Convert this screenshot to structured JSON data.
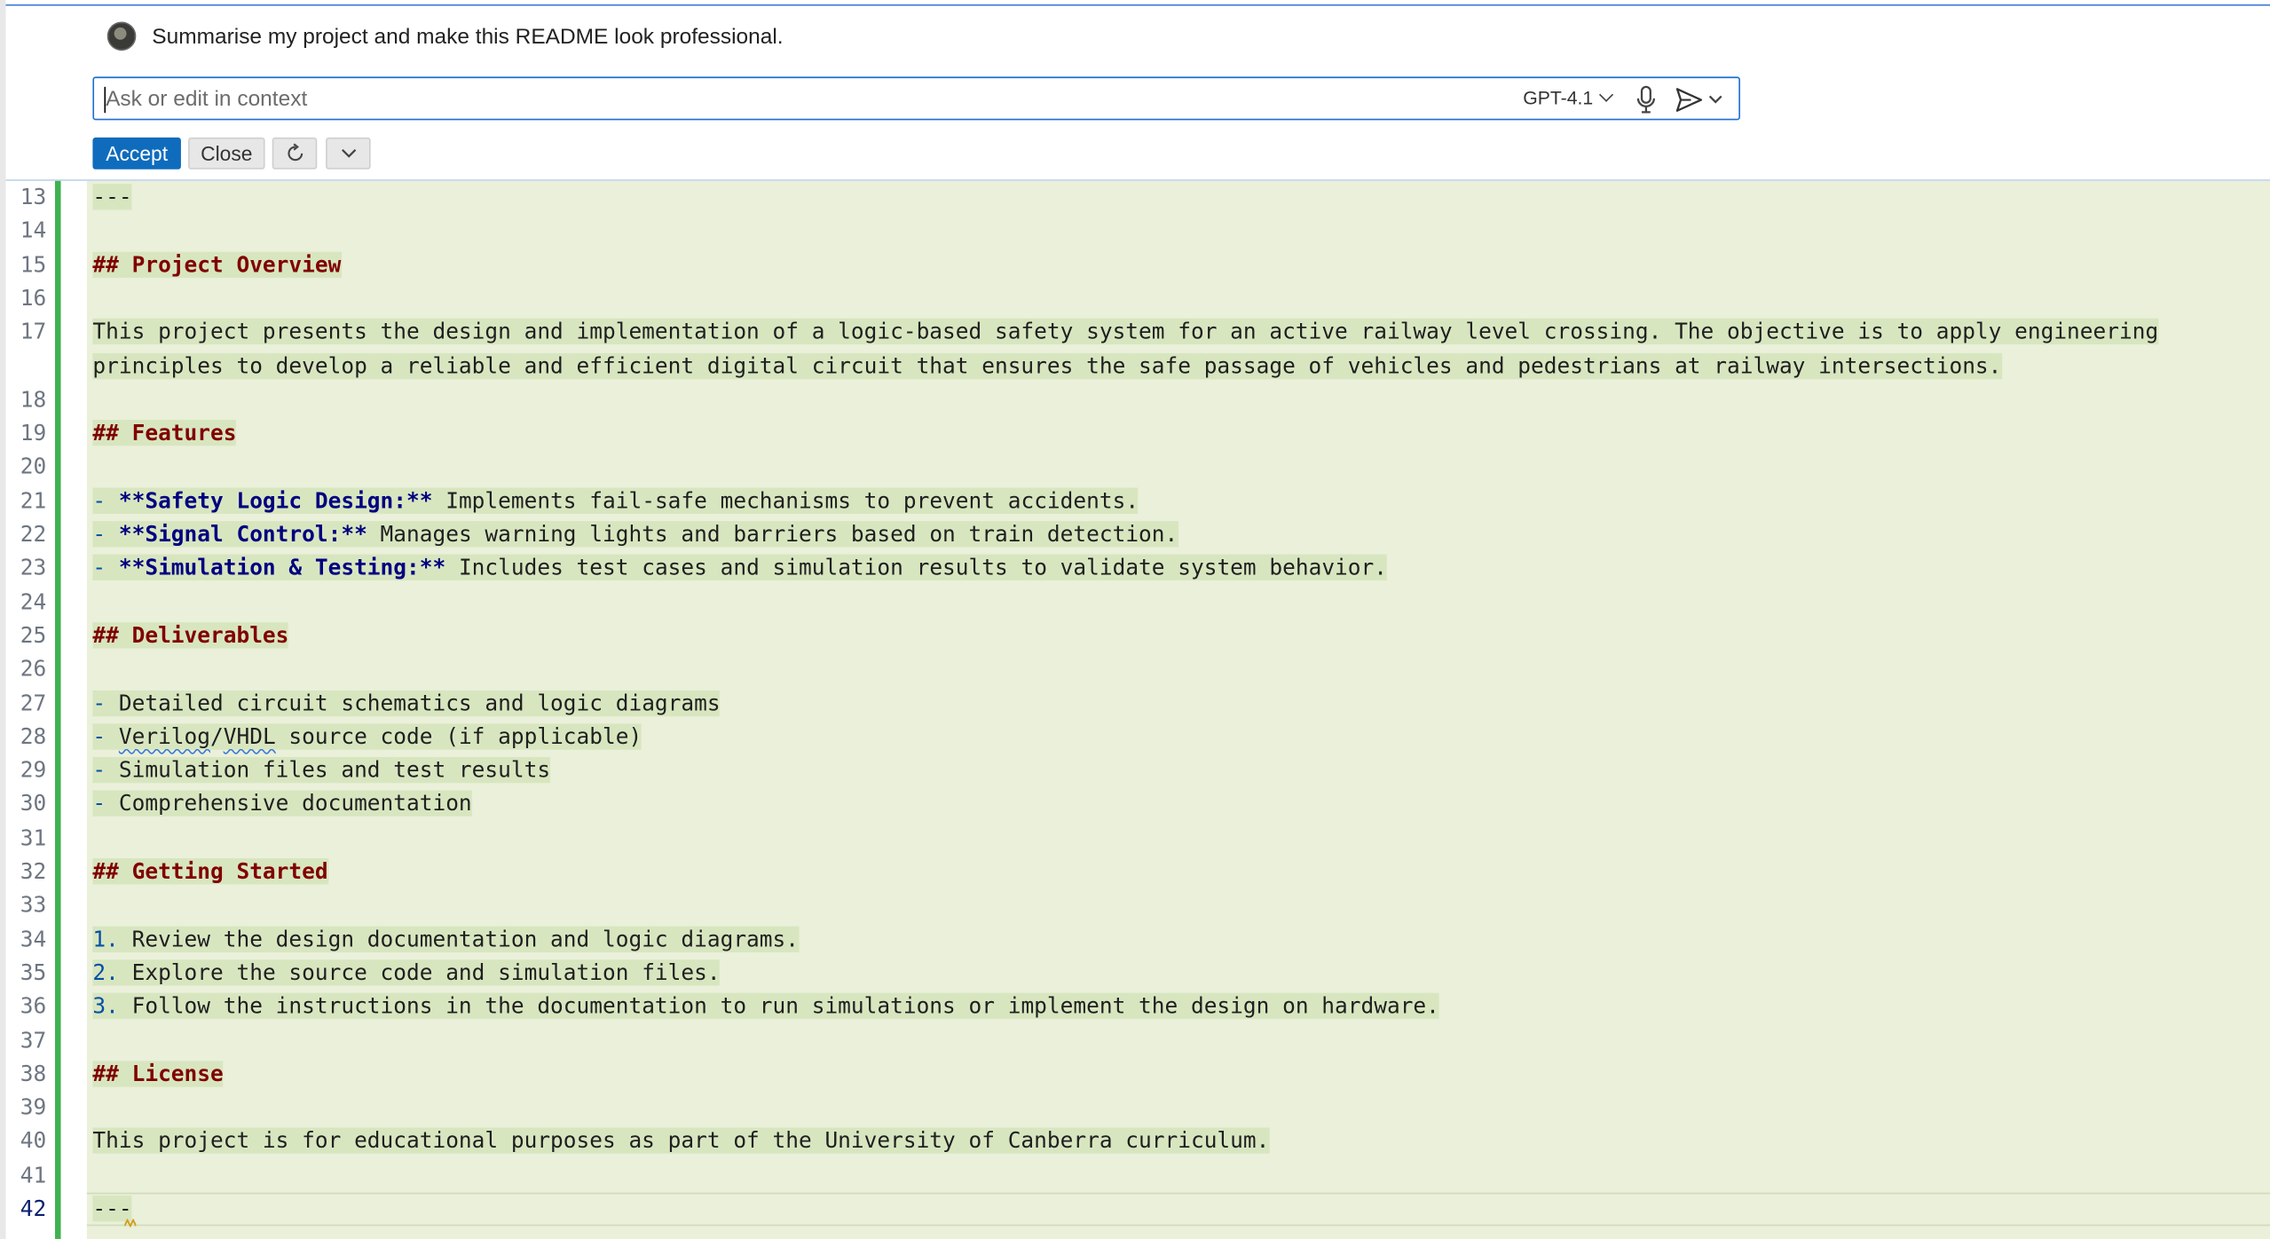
{
  "chat": {
    "prompt_text": "Summarise my project and make this README look professional.",
    "input_placeholder": "Ask or edit in context",
    "input_value": "",
    "model_label": "GPT-4.1",
    "icons": [
      "avatar",
      "chevron-down-icon",
      "microphone-icon",
      "send-icon",
      "refresh-icon"
    ],
    "buttons": {
      "accept": "Accept",
      "close": "Close"
    },
    "accent_color": "#0f6cbd"
  },
  "editor": {
    "insert_background": "#eaf0da",
    "diff_bar_color": "#3fb24f",
    "active_line_number": "42",
    "lines": [
      {
        "n": "13",
        "segs": [
          {
            "t": "---",
            "c": "plain"
          }
        ]
      },
      {
        "n": "14",
        "segs": []
      },
      {
        "n": "15",
        "segs": [
          {
            "t": "## Project Overview",
            "c": "head"
          }
        ]
      },
      {
        "n": "16",
        "segs": []
      },
      {
        "n": "17",
        "segs": [
          {
            "t": "This project presents the design and implementation of a logic-based safety system for an active railway level crossing. The objective is to apply engineering",
            "c": "plain"
          }
        ]
      },
      {
        "n": "",
        "segs": [
          {
            "t": "principles to develop a reliable and efficient digital circuit that ensures the safe passage of vehicles and pedestrians at railway intersections.",
            "c": "plain"
          }
        ]
      },
      {
        "n": "18",
        "segs": []
      },
      {
        "n": "19",
        "segs": [
          {
            "t": "## Features",
            "c": "head"
          }
        ]
      },
      {
        "n": "20",
        "segs": []
      },
      {
        "n": "21",
        "segs": [
          {
            "t": "- ",
            "c": "list"
          },
          {
            "t": "**Safety Logic Design:**",
            "c": "bold"
          },
          {
            "t": " Implements fail-safe mechanisms to prevent accidents.",
            "c": "plain"
          }
        ]
      },
      {
        "n": "22",
        "segs": [
          {
            "t": "- ",
            "c": "list"
          },
          {
            "t": "**Signal Control:**",
            "c": "bold"
          },
          {
            "t": " Manages warning lights and barriers based on train detection.",
            "c": "plain"
          }
        ]
      },
      {
        "n": "23",
        "segs": [
          {
            "t": "- ",
            "c": "list"
          },
          {
            "t": "**Simulation & Testing:**",
            "c": "bold"
          },
          {
            "t": " Includes test cases and simulation results to validate system behavior.",
            "c": "plain"
          }
        ]
      },
      {
        "n": "24",
        "segs": []
      },
      {
        "n": "25",
        "segs": [
          {
            "t": "## Deliverables",
            "c": "head"
          }
        ]
      },
      {
        "n": "26",
        "segs": []
      },
      {
        "n": "27",
        "segs": [
          {
            "t": "- ",
            "c": "list"
          },
          {
            "t": "Detailed circuit schematics and logic diagrams",
            "c": "plain"
          }
        ]
      },
      {
        "n": "28",
        "segs": [
          {
            "t": "- ",
            "c": "list"
          },
          {
            "t": "Verilog",
            "c": "squig"
          },
          {
            "t": "/",
            "c": "plain"
          },
          {
            "t": "VHDL",
            "c": "squig"
          },
          {
            "t": " source code (if applicable)",
            "c": "plain"
          }
        ]
      },
      {
        "n": "29",
        "segs": [
          {
            "t": "- ",
            "c": "list"
          },
          {
            "t": "Simulation files and test results",
            "c": "plain"
          }
        ]
      },
      {
        "n": "30",
        "segs": [
          {
            "t": "- ",
            "c": "list"
          },
          {
            "t": "Comprehensive documentation",
            "c": "plain"
          }
        ]
      },
      {
        "n": "31",
        "segs": []
      },
      {
        "n": "32",
        "segs": [
          {
            "t": "## Getting Started",
            "c": "head"
          }
        ]
      },
      {
        "n": "33",
        "segs": []
      },
      {
        "n": "34",
        "segs": [
          {
            "t": "1. ",
            "c": "list"
          },
          {
            "t": "Review the design documentation and logic diagrams.",
            "c": "plain"
          }
        ]
      },
      {
        "n": "35",
        "segs": [
          {
            "t": "2. ",
            "c": "list"
          },
          {
            "t": "Explore the source code and simulation files.",
            "c": "plain"
          }
        ]
      },
      {
        "n": "36",
        "segs": [
          {
            "t": "3. ",
            "c": "list"
          },
          {
            "t": "Follow the instructions in the documentation to run simulations or implement the design on hardware.",
            "c": "plain"
          }
        ]
      },
      {
        "n": "37",
        "segs": []
      },
      {
        "n": "38",
        "segs": [
          {
            "t": "## License",
            "c": "head"
          }
        ]
      },
      {
        "n": "39",
        "segs": []
      },
      {
        "n": "40",
        "segs": [
          {
            "t": "This project is for educational purposes as part of the University of Canberra curriculum.",
            "c": "plain"
          }
        ]
      },
      {
        "n": "41",
        "segs": []
      },
      {
        "n": "42",
        "segs": [
          {
            "t": "---",
            "c": "plain"
          }
        ]
      }
    ]
  }
}
